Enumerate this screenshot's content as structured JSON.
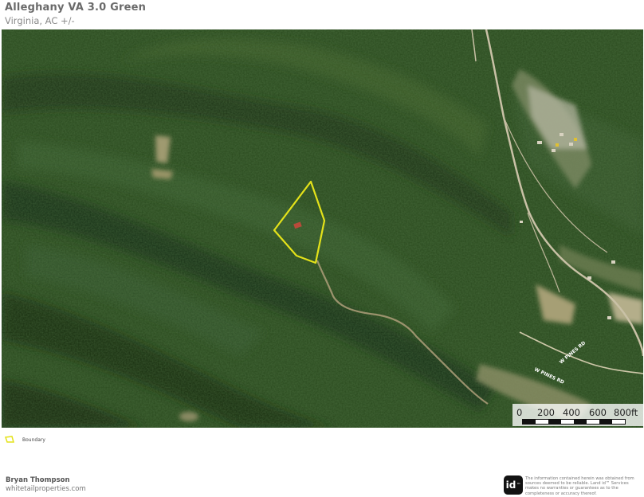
{
  "header": {
    "title": "Alleghany VA 3.0 Green",
    "subtitle": "Virginia,  AC +/-"
  },
  "map": {
    "type": "satellite",
    "boundary_color": "#e4e21a",
    "road_labels": [
      "W PINES RD",
      "W PINES RD"
    ],
    "scale": {
      "ticks": [
        "0",
        "200",
        "400",
        "600",
        "800ft"
      ]
    }
  },
  "legend": {
    "label": "Boundary"
  },
  "footer": {
    "agent_name": "Bryan Thompson",
    "website": "whitetailproperties.com",
    "logo_text": "id",
    "logo_mark": "™",
    "disclaimer": "The information contained herein was obtained from sources deemed to be reliable. Land id™ Services makes no warranties or guarantees as to the completeness or accuracy thereof."
  }
}
